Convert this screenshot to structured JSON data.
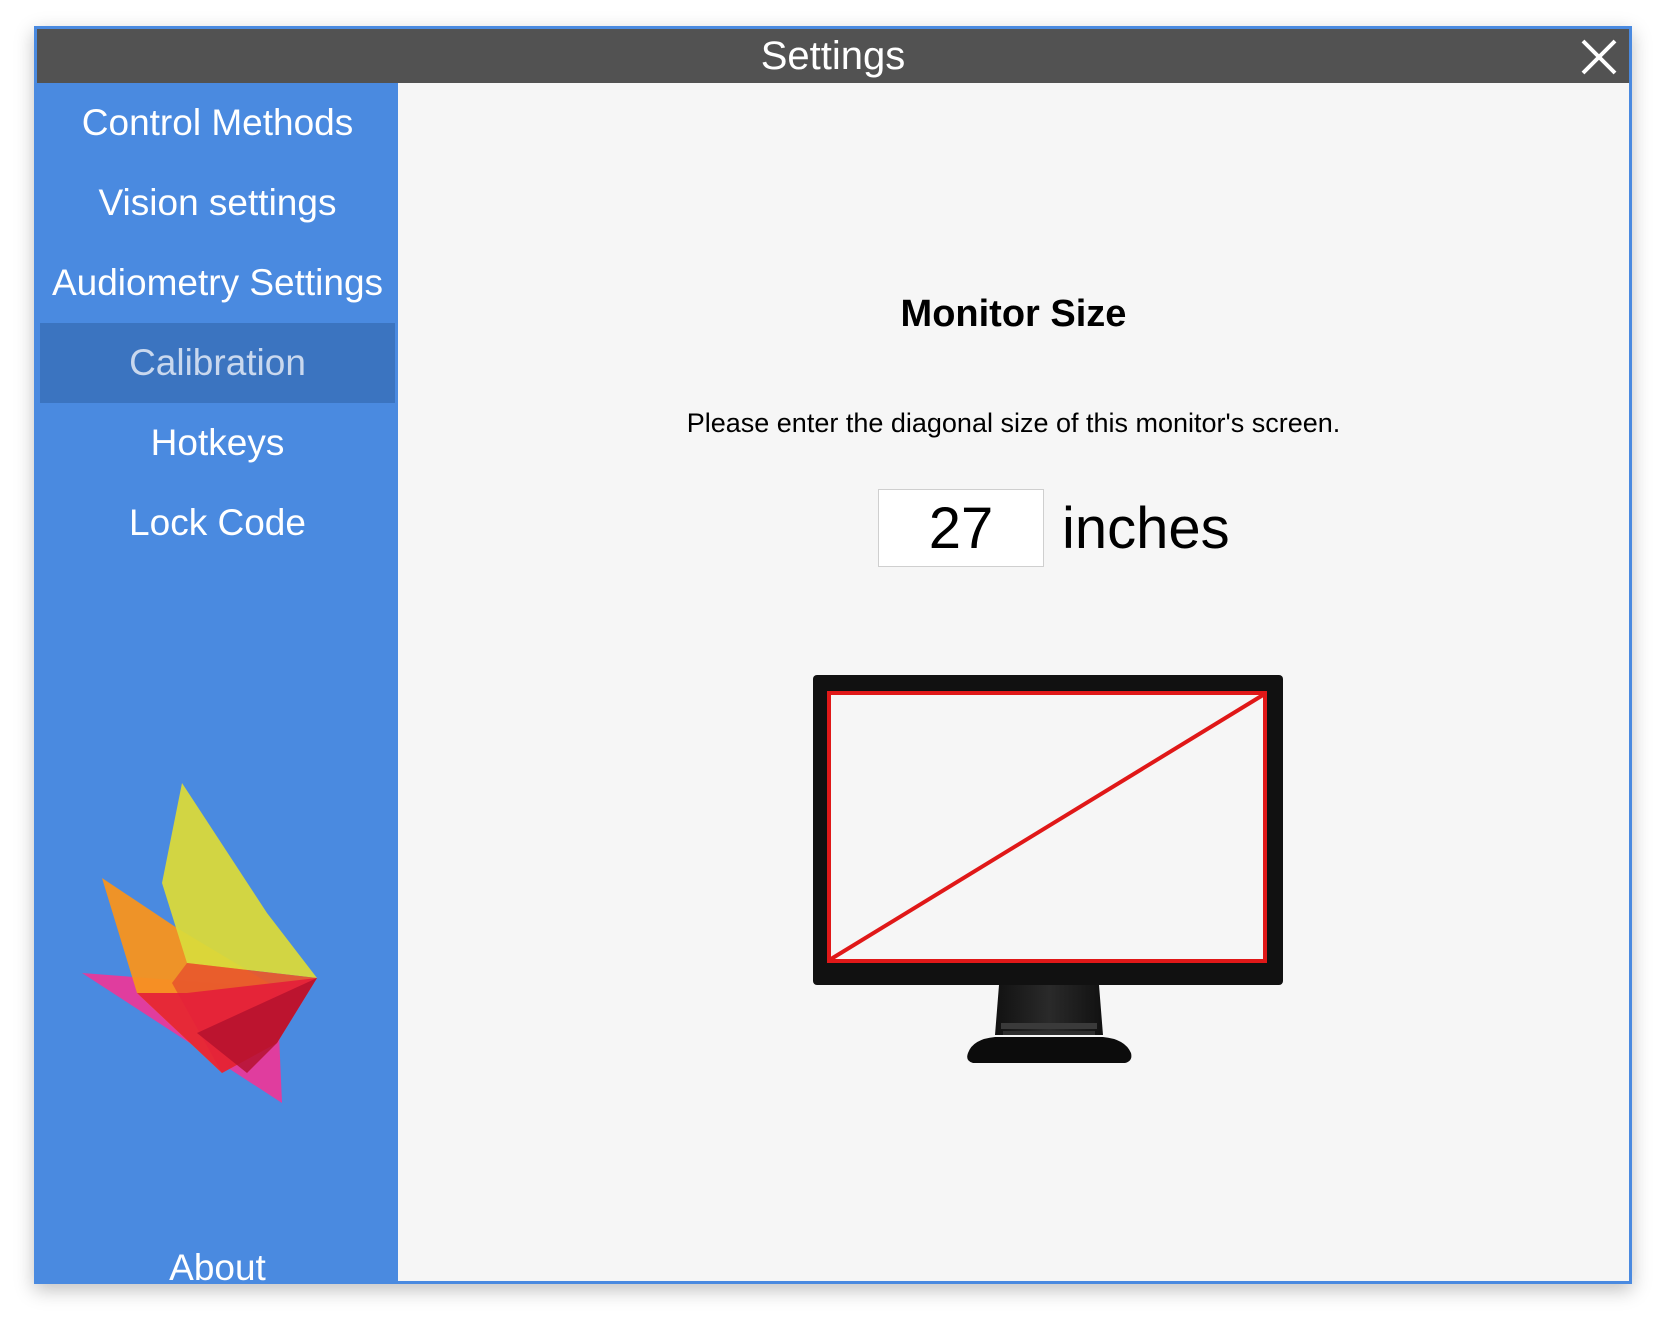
{
  "window": {
    "title": "Settings"
  },
  "sidebar": {
    "items": [
      {
        "label": "Control Methods",
        "active": false
      },
      {
        "label": "Vision settings",
        "active": false
      },
      {
        "label": "Audiometry Settings",
        "active": false
      },
      {
        "label": "Calibration",
        "active": true
      },
      {
        "label": "Hotkeys",
        "active": false
      },
      {
        "label": "Lock Code",
        "active": false
      }
    ],
    "about_label": "About"
  },
  "main": {
    "heading": "Monitor Size",
    "instruction": "Please enter the diagonal size of this monitor's screen.",
    "size_value": "27",
    "unit_label": "inches"
  },
  "colors": {
    "sidebar": "#4a8ae0",
    "sidebar_active": "#3b74c0",
    "titlebar": "#525252",
    "diagonal": "#e01818"
  }
}
